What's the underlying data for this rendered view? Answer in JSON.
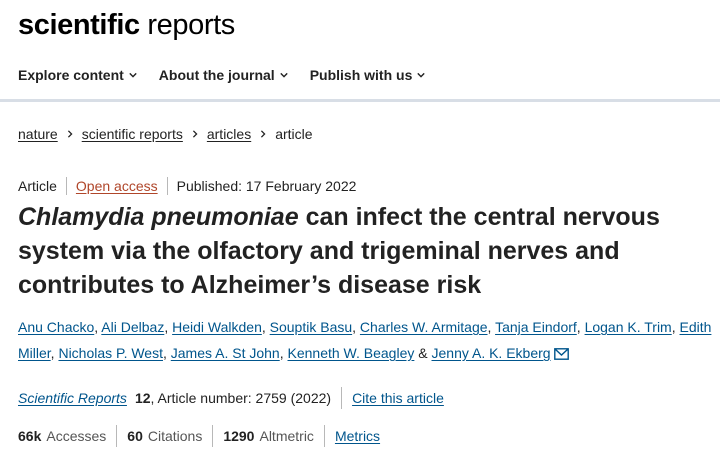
{
  "header": {
    "logo_bold": "scientific",
    "logo_light": " reports"
  },
  "nav": {
    "items": [
      {
        "label": "Explore content",
        "icon": "chevron-down-icon"
      },
      {
        "label": "About the journal",
        "icon": "chevron-down-icon"
      },
      {
        "label": "Publish with us",
        "icon": "chevron-down-icon"
      }
    ]
  },
  "breadcrumb": {
    "items": [
      "nature",
      "scientific reports",
      "articles"
    ],
    "current": "article"
  },
  "meta": {
    "type": "Article",
    "open_access": "Open access",
    "published": "Published: 17 February 2022"
  },
  "title": {
    "italic": "Chlamydia pneumoniae",
    "rest": " can infect the central nervous system via the olfactory and trigeminal nerves and contributes to Alzheimer’s disease risk"
  },
  "authors": [
    "Anu Chacko",
    "Ali Delbaz",
    "Heidi Walkden",
    "Souptik Basu",
    "Charles W. Armitage",
    "Tanja Eindorf",
    "Logan K. Trim",
    "Edith Miller",
    "Nicholas P. West",
    "James A. St John",
    "Kenneth W. Beagley",
    "Jenny A. K. Ekberg"
  ],
  "authors_conj": "&",
  "journal": {
    "name": "Scientific Reports",
    "volume": "12",
    "article_number": ", Article number: 2759 (2022)",
    "cite_label": "Cite this article"
  },
  "metrics": {
    "accesses_value": "66k",
    "accesses_label": "Accesses",
    "citations_value": "60",
    "citations_label": "Citations",
    "altmetric_value": "1290",
    "altmetric_label": "Altmetric",
    "metrics_link": "Metrics"
  },
  "colors": {
    "link": "#00558c",
    "open_access": "#b0462a",
    "nav_border": "#d8dee6"
  }
}
